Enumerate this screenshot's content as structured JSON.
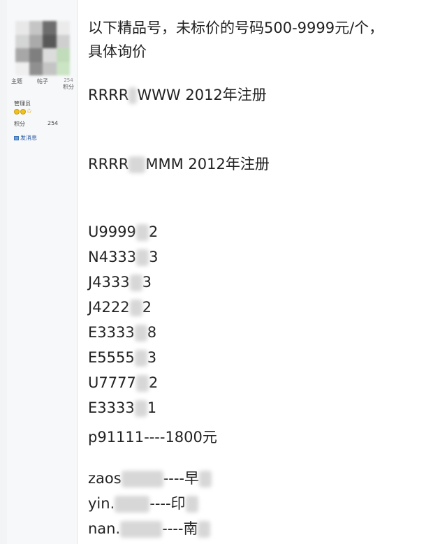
{
  "sidebar": {
    "stats": [
      {
        "label": "主题",
        "value": ""
      },
      {
        "label": "帖子",
        "value": ""
      },
      {
        "label": "积分",
        "value": "254"
      }
    ],
    "role": "管理员",
    "score_label": "积分",
    "score_value": "254",
    "message_label": "发消息"
  },
  "post": {
    "intro_line1": "以下精品号，未标价的号码500-9999元/个，",
    "intro_line2": "具体询价",
    "line_r1_a": "RRRR",
    "line_r1_b": "WWW  2012年注册",
    "line_r2_a": "RRRR",
    "line_r2_b": "MMM  2012年注册",
    "numbers": [
      {
        "a": "U9999",
        "b": "2"
      },
      {
        "a": "N4333",
        "b": "3"
      },
      {
        "a": "J4333",
        "b": "3"
      },
      {
        "a": "J4222",
        "b": "2"
      },
      {
        "a": "E3333",
        "b": "8"
      },
      {
        "a": "E5555",
        "b": "3"
      },
      {
        "a": "U7777",
        "b": "2"
      },
      {
        "a": "E3333",
        "b": "1"
      }
    ],
    "priced_line": "p91111----1800元",
    "pinyin": [
      {
        "a": "zaos",
        "b": "----早"
      },
      {
        "a": "yin.",
        "b": "----印"
      },
      {
        "a": "nan.",
        "b": "----南"
      }
    ]
  }
}
